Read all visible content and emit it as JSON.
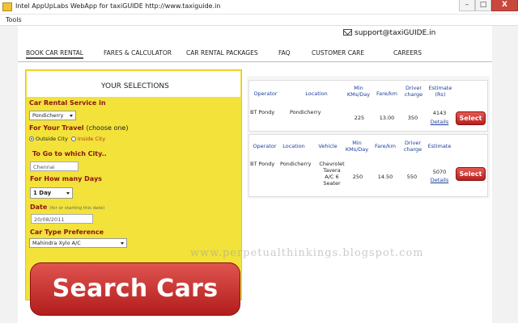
{
  "window": {
    "title": "Intel AppUpLabs WebApp for taxiGUIDE http://www.taxiguide.in",
    "controls": {
      "minimize": "–",
      "maximize": "□",
      "close": "X"
    }
  },
  "menubar": {
    "tools": "Tools"
  },
  "header": {
    "support_email": "support@taxiGUIDE.in"
  },
  "nav": {
    "items": [
      "BOOK CAR RENTAL",
      "FARES & CALCULATOR",
      "CAR RENTAL PACKAGES",
      "FAQ",
      "CUSTOMER CARE",
      "CAREERS"
    ]
  },
  "selections": {
    "heading": "YOUR SELECTIONS",
    "service_label": "Car Rental Service in",
    "service_value": "Pondicherry",
    "travel_label": "For Your Travel",
    "travel_sub": "(choose one)",
    "outside_city": "Outside City",
    "inside_city": "Inside City",
    "goto_label": "To Go to which City..",
    "goto_value": "Chennai",
    "days_label": "For How many Days",
    "days_value": "1 Day",
    "date_label": "Date",
    "date_hint": "(for or starting this date)",
    "date_value": "20/08/2011",
    "cartype_label": "Car Type Preference",
    "cartype_value": "Mahindra Xylo A/C",
    "search_button": "Search Cars"
  },
  "results_local": {
    "headers": [
      "Operator",
      "Location",
      "Min KMs/Day",
      "Fare/km",
      "Driver charge",
      "Estimate (Rs)"
    ],
    "row": {
      "operator": "BT Pondy",
      "location": "Pondicherry",
      "min_kms": "225",
      "fare": "13.00",
      "driver": "350",
      "estimate": "4143",
      "details": "Details",
      "select": "Select"
    }
  },
  "results_outstation": {
    "headers": [
      "Operator",
      "Location",
      "Vehicle",
      "Min KMs/Day",
      "Fare/km",
      "Driver charge",
      "Estimate"
    ],
    "row": {
      "operator": "BT Pondy",
      "location": "Pondicherry",
      "vehicle": "Chevrolet Tavera A/C 6 Seater",
      "min_kms": "250",
      "fare": "14.50",
      "driver": "550",
      "estimate": "5070",
      "details": "Details",
      "select": "Select"
    }
  },
  "watermark": "www.perpetualthinkings.blogspot.com",
  "colors": {
    "panel_yellow": "#f2e23a",
    "label_red": "#8a1414",
    "button_red": "#c0302a",
    "link_blue": "#1a3e9a"
  }
}
